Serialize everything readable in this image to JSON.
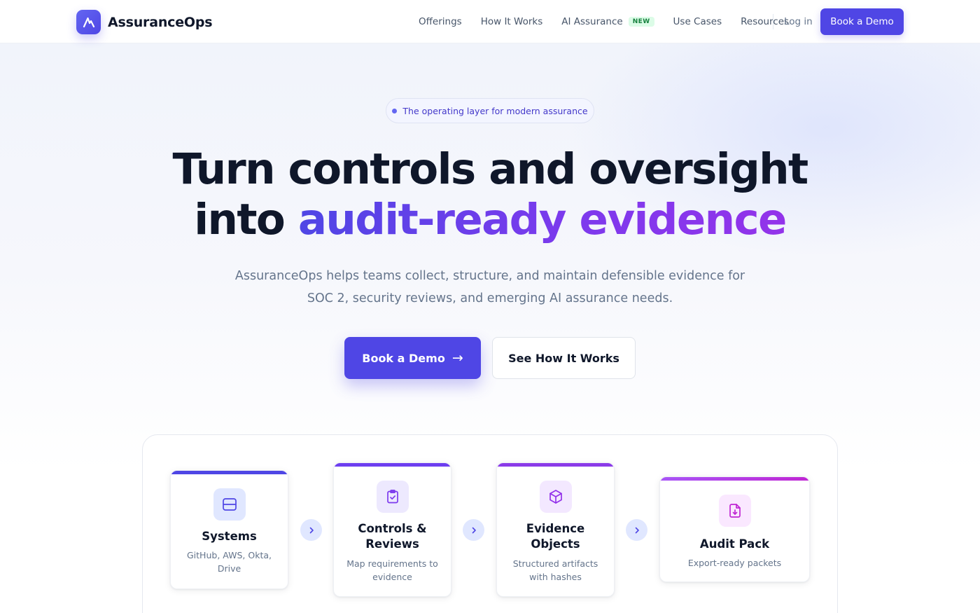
{
  "nav": {
    "brand": "AssuranceOps",
    "links": [
      {
        "label": "Offerings"
      },
      {
        "label": "How It Works"
      },
      {
        "label": "AI Assurance",
        "badge": "NEW"
      },
      {
        "label": "Use Cases"
      },
      {
        "label": "Resources"
      }
    ],
    "login": "Log in",
    "cta": "Book a Demo"
  },
  "hero": {
    "pill": "The operating layer for modern assurance",
    "headline_line1": "Turn controls and oversight",
    "headline_line2_prefix": "into ",
    "headline_line2_highlight": "audit-ready evidence",
    "subtext": "AssuranceOps helps teams collect, structure, and maintain defensible evidence for SOC 2, security reviews, and emerging AI assurance needs.",
    "primary_cta": "Book a Demo",
    "primary_cta_arrow": "→",
    "secondary_cta": "See How It Works"
  },
  "flow": {
    "steps": [
      {
        "title": "Systems",
        "description": "GitHub, AWS, Okta, Drive",
        "icon": "server-icon",
        "accent": "#4f46e5"
      },
      {
        "title": "Controls & Reviews",
        "description": "Map requirements to evidence",
        "icon": "clipboard-check-icon",
        "accent": "#7c3aed"
      },
      {
        "title": "Evidence Objects",
        "description": "Structured artifacts with hashes",
        "icon": "cube-icon",
        "accent": "#9333ea"
      },
      {
        "title": "Audit Pack",
        "description": "Export-ready packets",
        "icon": "file-download-icon",
        "accent": "#c026d3"
      }
    ],
    "connector_icon": "chevron-right-icon"
  },
  "colors": {
    "primary": "#4f46e5",
    "violet": "#7c3aed",
    "purple": "#9333ea",
    "fuchsia": "#c026d3",
    "text": "#0f172a",
    "muted": "#64748b"
  }
}
